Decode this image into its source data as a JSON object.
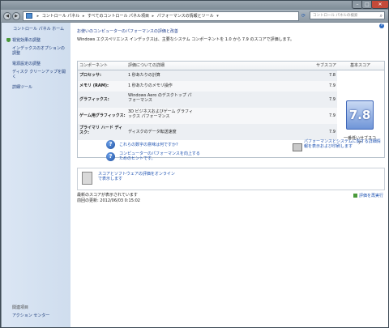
{
  "window": {
    "search_placeholder": "コントロール パネルの検索",
    "address_crumbs": [
      "コントロール パネル",
      "すべてのコントロール パネル項目",
      "パフォーマンスの情報とツール"
    ]
  },
  "sidebar": {
    "home": "コントロール パネル ホーム",
    "items": [
      "視覚効果の調整",
      "インデックスのオプションの調整",
      "電源設定の調整",
      "ディスク クリーンアップを開く",
      "詳細ツール"
    ],
    "see_also": "関連項目",
    "action_center": "アクション センター"
  },
  "main": {
    "title": "お使いのコンピューターのパフォーマンスの評価と改善",
    "intro": "Windows エクスペリエンス インデックスは、主要なシステム コンポーネントを 1.0 から 7.9 のスコアで評価します。",
    "headers": {
      "component": "コンポーネント",
      "rated": "評価についての詳細",
      "subscore": "サブスコア",
      "base": "基本スコア"
    },
    "rows": [
      {
        "component": "プロセッサ:",
        "desc": "1 秒あたりの計算",
        "score": "7.8"
      },
      {
        "component": "メモリ (RAM):",
        "desc": "1 秒あたりのメモリ操作",
        "score": "7.9"
      },
      {
        "component": "グラフィックス:",
        "desc": "Windows Aero のデスクトップ パフォーマンス",
        "score": "7.9"
      },
      {
        "component": "ゲーム用グラフィックス:",
        "desc": "3D ビジネスおよびゲーム グラフィックス パフォーマンス",
        "score": "7.9"
      },
      {
        "component": "プライマリ ハード ディスク:",
        "desc": "ディスクのデータ転送速度",
        "score": "7.9"
      }
    ],
    "base_score": "7.8",
    "base_caption": "一番低いサブスコア",
    "link_meaning": "これらの数字の意味は何ですか?",
    "link_tips": "コンピューターのパフォーマンスを向上するためのヒントです。",
    "link_details": "パフォーマンスとシステムに関する詳細情報を表示および印刷します",
    "link_online": "スコアとソフトウェアの評価をオンラインで表示します",
    "status_current": "最新のスコアが表示されています",
    "status_updated": "前回の更新: 2012/06/03 0:15:02",
    "rerun": "評価を再実行"
  }
}
